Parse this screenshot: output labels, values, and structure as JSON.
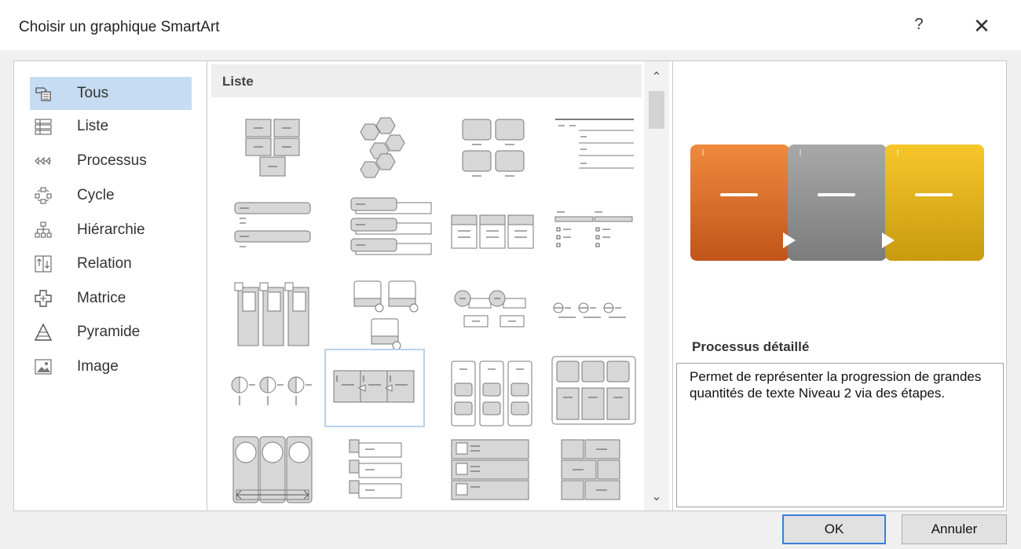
{
  "window": {
    "title": "Choisir un graphique SmartArt",
    "help_glyph": "?",
    "close_glyph": "✕"
  },
  "categories": [
    {
      "label": "Tous",
      "icon": "all-icon",
      "selected": true
    },
    {
      "label": "Liste",
      "icon": "list-icon"
    },
    {
      "label": "Processus",
      "icon": "process-icon"
    },
    {
      "label": "Cycle",
      "icon": "cycle-icon"
    },
    {
      "label": "Hiérarchie",
      "icon": "hierarchy-icon"
    },
    {
      "label": "Relation",
      "icon": "relationship-icon"
    },
    {
      "label": "Matrice",
      "icon": "matrix-icon"
    },
    {
      "label": "Pyramide",
      "icon": "pyramid-icon"
    },
    {
      "label": "Image",
      "icon": "picture-icon"
    }
  ],
  "gallery": {
    "section_header": "Liste",
    "scroll_up_glyph": "⌃",
    "scroll_down_glyph": "⌄"
  },
  "preview": {
    "title": "Processus détaillé",
    "description": "Permet de représenter la progression de grandes quantités de texte Niveau 2 via des étapes.",
    "colors": {
      "step1": "#d9641f",
      "step2": "#8f8f8f",
      "step3": "#e6b416"
    }
  },
  "buttons": {
    "ok": "OK",
    "cancel": "Annuler"
  },
  "colors": {
    "selection": "#c5dcf3",
    "accent": "#3c7fd6"
  }
}
